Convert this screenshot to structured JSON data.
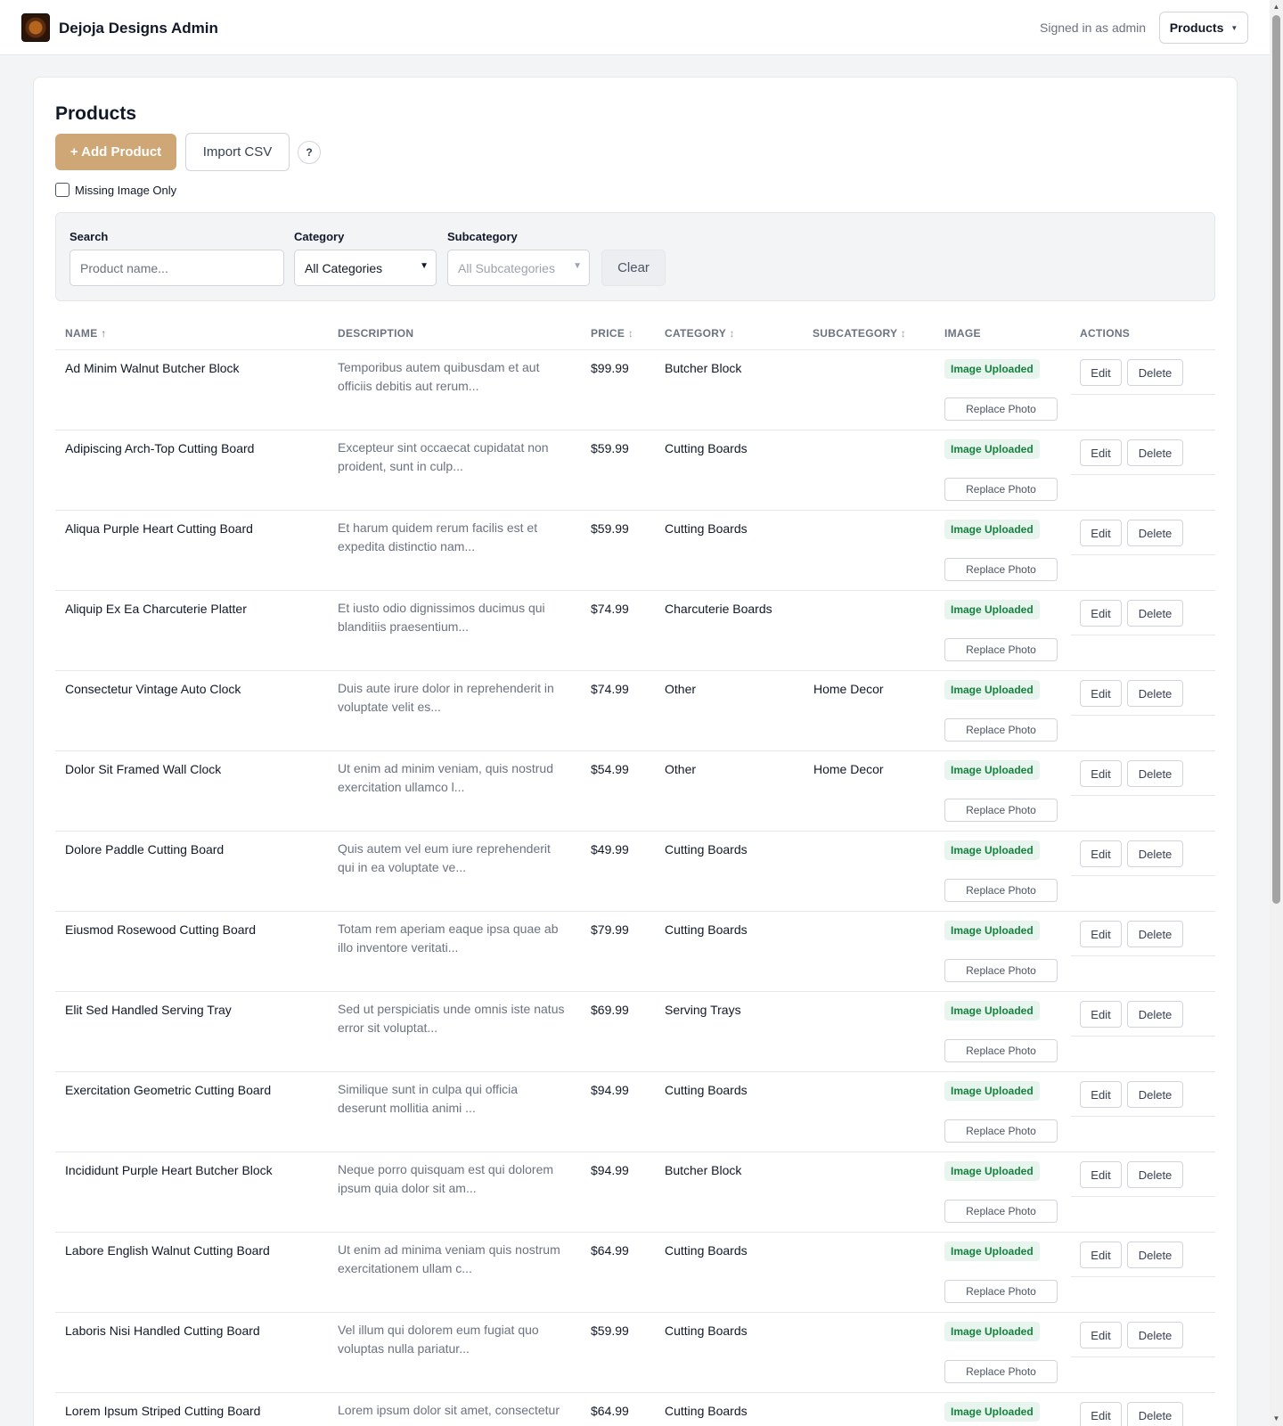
{
  "app": {
    "title": "Dejoja Designs Admin",
    "signed_in": "Signed in as admin",
    "nav_menu": "Products"
  },
  "page": {
    "title": "Products",
    "add_button": "+ Add Product",
    "import_button": "Import CSV",
    "help_button": "?",
    "missing_image_label": "Missing Image Only",
    "missing_image_checked": false
  },
  "filters": {
    "search_label": "Search",
    "search_placeholder": "Product name...",
    "search_value": "",
    "category_label": "Category",
    "category_value": "All Categories",
    "subcategory_label": "Subcategory",
    "subcategory_value": "All Subcategories",
    "clear_button": "Clear"
  },
  "table": {
    "columns": {
      "name": "NAME",
      "name_sort": "↑",
      "description": "DESCRIPTION",
      "price": "PRICE",
      "price_sort": "↕",
      "category": "CATEGORY",
      "category_sort": "↕",
      "subcategory": "SUBCATEGORY",
      "subcategory_sort": "↕",
      "image": "IMAGE",
      "actions": "ACTIONS"
    },
    "image_status": "Image Uploaded",
    "replace_label": "Replace Photo",
    "edit_label": "Edit",
    "delete_label": "Delete",
    "rows": [
      {
        "name": "Ad Minim Walnut Butcher Block",
        "desc1": "Temporibus autem quibusdam et aut",
        "desc2": "officiis debitis aut rerum...",
        "price": "$99.99",
        "category": "Butcher Block",
        "subcategory": ""
      },
      {
        "name": "Adipiscing Arch-Top Cutting Board",
        "desc1": "Excepteur sint occaecat cupidatat non",
        "desc2": "proident, sunt in culp...",
        "price": "$59.99",
        "category": "Cutting Boards",
        "subcategory": ""
      },
      {
        "name": "Aliqua Purple Heart Cutting Board",
        "desc1": "Et harum quidem rerum facilis est et",
        "desc2": "expedita distinctio nam...",
        "price": "$59.99",
        "category": "Cutting Boards",
        "subcategory": ""
      },
      {
        "name": "Aliquip Ex Ea Charcuterie Platter",
        "desc1": "Et iusto odio dignissimos ducimus qui",
        "desc2": "blanditiis praesentium...",
        "price": "$74.99",
        "category": "Charcuterie Boards",
        "subcategory": ""
      },
      {
        "name": "Consectetur Vintage Auto Clock",
        "desc1": "Duis aute irure dolor in reprehenderit in",
        "desc2": "voluptate velit es...",
        "price": "$74.99",
        "category": "Other",
        "subcategory": "Home Decor"
      },
      {
        "name": "Dolor Sit Framed Wall Clock",
        "desc1": "Ut enim ad minim veniam, quis nostrud",
        "desc2": "exercitation ullamco l...",
        "price": "$54.99",
        "category": "Other",
        "subcategory": "Home Decor"
      },
      {
        "name": "Dolore Paddle Cutting Board",
        "desc1": "Quis autem vel eum iure reprehenderit",
        "desc2": "qui in ea voluptate ve...",
        "price": "$49.99",
        "category": "Cutting Boards",
        "subcategory": ""
      },
      {
        "name": "Eiusmod Rosewood Cutting Board",
        "desc1": "Totam rem aperiam eaque ipsa quae ab",
        "desc2": "illo inventore veritati...",
        "price": "$79.99",
        "category": "Cutting Boards",
        "subcategory": ""
      },
      {
        "name": "Elit Sed Handled Serving Tray",
        "desc1": "Sed ut perspiciatis unde omnis iste natus",
        "desc2": "error sit voluptat...",
        "price": "$69.99",
        "category": "Serving Trays",
        "subcategory": ""
      },
      {
        "name": "Exercitation Geometric Cutting Board",
        "desc1": "Similique sunt in culpa qui officia",
        "desc2": "deserunt mollitia animi ...",
        "price": "$94.99",
        "category": "Cutting Boards",
        "subcategory": ""
      },
      {
        "name": "Incididunt Purple Heart Butcher Block",
        "desc1": "Neque porro quisquam est qui dolorem",
        "desc2": "ipsum quia dolor sit am...",
        "price": "$94.99",
        "category": "Butcher Block",
        "subcategory": ""
      },
      {
        "name": "Labore English Walnut Cutting Board",
        "desc1": "Ut enim ad minima veniam quis nostrum",
        "desc2": "exercitationem ullam c...",
        "price": "$64.99",
        "category": "Cutting Boards",
        "subcategory": ""
      },
      {
        "name": "Laboris Nisi Handled Cutting Board",
        "desc1": "Vel illum qui dolorem eum fugiat quo",
        "desc2": "voluptas nulla pariatur...",
        "price": "$59.99",
        "category": "Cutting Boards",
        "subcategory": ""
      },
      {
        "name": "Lorem Ipsum Striped Cutting Board",
        "desc1": "Lorem ipsum dolor sit amet, consectetur",
        "desc2": "",
        "price": "$64.99",
        "category": "Cutting Boards",
        "subcategory": ""
      }
    ]
  }
}
